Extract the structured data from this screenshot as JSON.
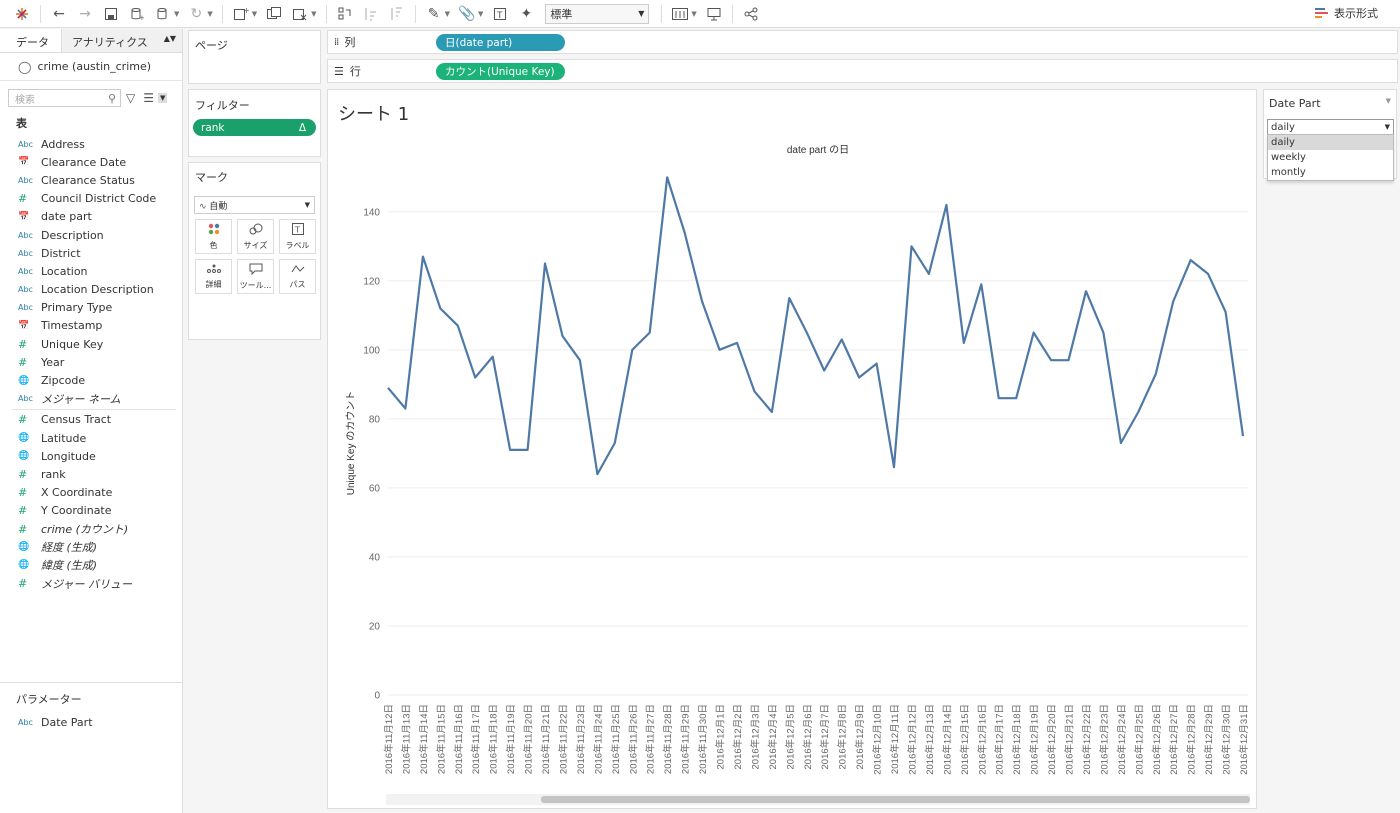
{
  "toolbar": {
    "fit_value": "標準",
    "show_me_label": "表示形式"
  },
  "data_pane": {
    "tab_data": "データ",
    "tab_analytics": "アナリティクス",
    "datasource": "crime (austin_crime)",
    "search_placeholder": "検索",
    "section_tables": "表",
    "dimensions": [
      {
        "type": "Abc",
        "label": "Address"
      },
      {
        "type": "date",
        "label": "Clearance Date"
      },
      {
        "type": "Abc",
        "label": "Clearance Status"
      },
      {
        "type": "num",
        "label": "Council District Code"
      },
      {
        "type": "date",
        "label": "date part"
      },
      {
        "type": "Abc",
        "label": "Description"
      },
      {
        "type": "Abc",
        "label": "District"
      },
      {
        "type": "Abc",
        "label": "Location"
      },
      {
        "type": "Abc",
        "label": "Location Description"
      },
      {
        "type": "Abc",
        "label": "Primary Type"
      },
      {
        "type": "date",
        "label": "Timestamp"
      },
      {
        "type": "num",
        "label": "Unique Key"
      },
      {
        "type": "num",
        "label": "Year"
      },
      {
        "type": "geo",
        "label": "Zipcode"
      },
      {
        "type": "Abc",
        "label": "メジャー ネーム",
        "italic": true
      }
    ],
    "measures": [
      {
        "type": "num",
        "label": "Census Tract"
      },
      {
        "type": "geo",
        "label": "Latitude"
      },
      {
        "type": "geo",
        "label": "Longitude"
      },
      {
        "type": "num",
        "label": "rank"
      },
      {
        "type": "num",
        "label": "X Coordinate"
      },
      {
        "type": "num",
        "label": "Y Coordinate"
      },
      {
        "type": "num",
        "label": "crime (カウント)",
        "italic": true
      },
      {
        "type": "geo",
        "label": "経度 (生成)",
        "italic": true
      },
      {
        "type": "geo",
        "label": "緯度 (生成)",
        "italic": true
      },
      {
        "type": "num",
        "label": "メジャー バリュー",
        "italic": true
      }
    ],
    "parameters_label": "パラメーター",
    "parameters": [
      {
        "type": "Abc",
        "label": "Date Part"
      }
    ]
  },
  "pages_card": {
    "title": "ページ"
  },
  "filters_card": {
    "title": "フィルター",
    "pill": "rank",
    "pill_icon": "Δ"
  },
  "marks_card": {
    "title": "マーク",
    "type_value": "自動",
    "buttons": [
      {
        "icon": "color-icon",
        "label": "色"
      },
      {
        "icon": "size-icon",
        "label": "サイズ"
      },
      {
        "icon": "label-icon",
        "label": "ラベル"
      },
      {
        "icon": "detail-icon",
        "label": "詳細"
      },
      {
        "icon": "tooltip-icon",
        "label": "ツール..."
      },
      {
        "icon": "path-icon",
        "label": "パス"
      }
    ]
  },
  "shelves": {
    "columns_label": "列",
    "columns_pill": "日(date part)",
    "rows_label": "行",
    "rows_pill": "カウント(Unique Key)"
  },
  "view": {
    "sheet_title": "シート 1"
  },
  "param_control": {
    "title": "Date Part",
    "value": "daily",
    "options": [
      "daily",
      "weekly",
      "montly"
    ]
  },
  "chart_data": {
    "type": "line",
    "title": "date part の日",
    "ylabel": "Unique Key のカウント",
    "xlabel": "",
    "ylim": [
      0,
      150
    ],
    "yticks": [
      0,
      20,
      40,
      60,
      80,
      100,
      120,
      140
    ],
    "color": "#4e79a7",
    "grid": true,
    "x": [
      "2016年11月12日",
      "2016年11月13日",
      "2016年11月14日",
      "2016年11月15日",
      "2016年11月16日",
      "2016年11月17日",
      "2016年11月18日",
      "2016年11月19日",
      "2016年11月20日",
      "2016年11月21日",
      "2016年11月22日",
      "2016年11月23日",
      "2016年11月24日",
      "2016年11月25日",
      "2016年11月26日",
      "2016年11月27日",
      "2016年11月28日",
      "2016年11月29日",
      "2016年11月30日",
      "2016年12月1日",
      "2016年12月2日",
      "2016年12月3日",
      "2016年12月4日",
      "2016年12月5日",
      "2016年12月6日",
      "2016年12月7日",
      "2016年12月8日",
      "2016年12月9日",
      "2016年12月10日",
      "2016年12月11日",
      "2016年12月12日",
      "2016年12月13日",
      "2016年12月14日",
      "2016年12月15日",
      "2016年12月16日",
      "2016年12月17日",
      "2016年12月18日",
      "2016年12月19日",
      "2016年12月20日",
      "2016年12月21日",
      "2016年12月22日",
      "2016年12月23日",
      "2016年12月24日",
      "2016年12月25日",
      "2016年12月26日",
      "2016年12月27日",
      "2016年12月28日",
      "2016年12月29日",
      "2016年12月30日",
      "2016年12月31日"
    ],
    "series": [
      {
        "values": [
          89,
          83,
          127,
          112,
          107,
          92,
          98,
          71,
          71,
          125,
          104,
          97,
          64,
          73,
          100,
          105,
          150,
          134,
          114,
          100,
          102,
          88,
          82,
          115,
          105,
          94,
          103,
          92,
          96,
          66,
          130,
          122,
          142,
          102,
          119,
          86,
          86,
          105,
          97,
          97,
          117,
          105,
          73,
          82,
          93,
          114,
          126,
          122,
          111,
          75
        ]
      }
    ]
  }
}
